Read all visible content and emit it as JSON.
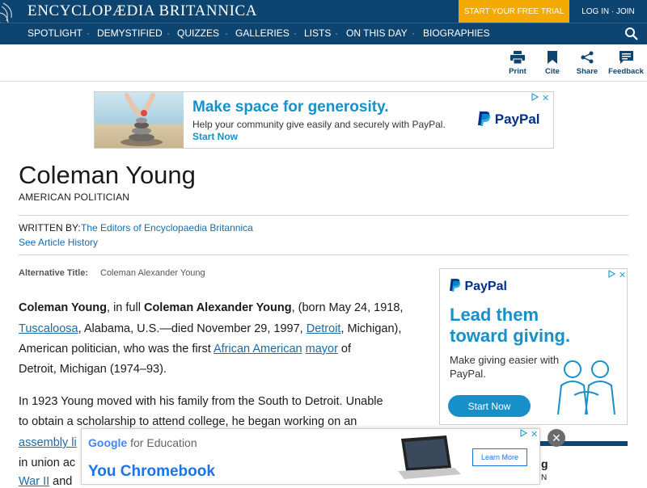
{
  "header": {
    "brand": "ENCYCLOPÆDIA BRITANNICA",
    "trial_label": "START YOUR FREE TRIAL",
    "login_label": "LOG IN · JOIN",
    "colors": {
      "navy": "#0e4470",
      "accent": "#f2a900"
    }
  },
  "nav": {
    "items": [
      "SPOTLIGHT",
      "DEMYSTIFIED",
      "QUIZZES",
      "GALLERIES",
      "LISTS",
      "ON THIS DAY",
      "BIOGRAPHIES"
    ],
    "separator": "·",
    "search_icon": "search-icon"
  },
  "toolbar": {
    "print": "Print",
    "cite": "Cite",
    "share": "Share",
    "feedback": "Feedback"
  },
  "ad_top": {
    "headline": "Make space for generosity.",
    "body": "Help your community give easily and securely with PayPal.",
    "cta": "Start Now",
    "brand": "PayPal",
    "close_glyph": "✕"
  },
  "article": {
    "title": "Coleman Young",
    "subtitle": "AMERICAN POLITICIAN",
    "written_label": "WRITTEN BY:",
    "written_by": "The Editors of Encyclopaedia Britannica",
    "history_link": "See Article History",
    "alt_label": "Alternative Title:",
    "alt_value": "Coleman Alexander Young",
    "p1": {
      "name": "Coleman Young",
      "t1": ", in full ",
      "fullname": "Coleman Alexander Young",
      "t2": ", (born May 24, 1918,",
      "link_tuscaloosa": "Tuscaloosa",
      "t3": ", Alabama, U.S.—died November 29, 1997, ",
      "link_detroit": "Detroit",
      "t4": ", Michigan),",
      "t5": "American politician, who was the first ",
      "link_african_american": "African American",
      "t6": " ",
      "link_mayor": "mayor",
      "t7": " of",
      "t8": "Detroit, Michigan (1974–93)."
    },
    "p2": {
      "l1": "In 1923 Young moved with his family from the South to Detroit. Unable",
      "l2": "to obtain a scholarship to attend college, he began working on an",
      "l3_link": "assembly li",
      "l4": "in union ac",
      "l5_link": "War II",
      "l5_rest": " and"
    }
  },
  "ad_right": {
    "brand": "PayPal",
    "headline": "Lead them toward giving.",
    "body": "Make giving easier with PayPal.",
    "cta": "Start Now"
  },
  "ad_bottom": {
    "brand_google": "Google",
    "brand_rest": " for Education",
    "headline": "You Chromebook",
    "cta": "Learn More",
    "close_glyph": "✕"
  },
  "side_box": {
    "partial_1": "g",
    "partial_2": "N"
  }
}
